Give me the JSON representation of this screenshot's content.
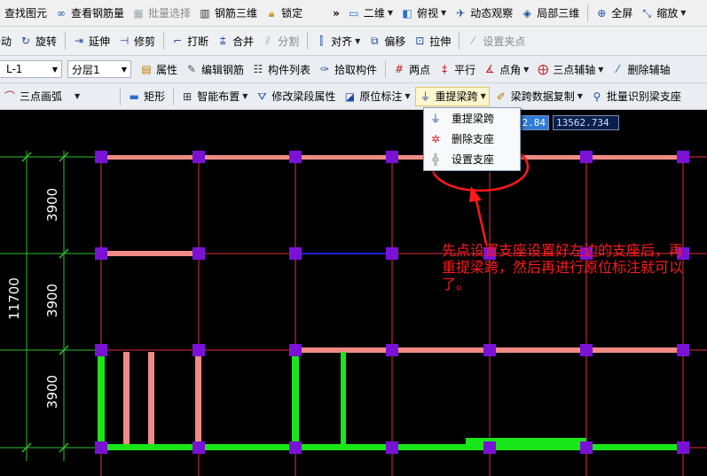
{
  "toolbar1": {
    "find_element": "查找图元",
    "view_rebar_qty": "查看钢筋量",
    "batch_select": "批量选择",
    "rebar_3d": "钢筋三维",
    "lock": "锁定",
    "overflow": "»",
    "view_2d": "二维",
    "top_view": "俯视",
    "dynamic_view": "动态观察",
    "local_3d": "局部三维",
    "full_screen": "全屏",
    "zoom": "缩放"
  },
  "toolbar2": {
    "move": "移动",
    "rotate": "旋转",
    "extend": "延伸",
    "trim": "修剪",
    "break": "打断",
    "merge": "合并",
    "split": "分割",
    "align": "对齐",
    "offset": "偏移",
    "stretch": "拉伸",
    "set_grip": "设置夹点"
  },
  "toolbar3": {
    "element_name": "L-1",
    "floor": "分层1",
    "properties": "属性",
    "edit_rebar": "编辑钢筋",
    "element_list": "构件列表",
    "pick_element": "拾取构件",
    "two_points": "两点",
    "parallel": "平行",
    "point_angle": "点角",
    "three_point_aux": "三点辅轴",
    "delete_aux": "删除辅轴"
  },
  "toolbar4": {
    "three_point_arc": "三点画弧",
    "rectangle": "矩形",
    "smart_layout": "智能布置",
    "modify_beam_props": "修改梁段属性",
    "in_place_label": "原位标注",
    "re_extract_span": "重提梁跨",
    "span_data_copy": "梁跨数据复制",
    "batch_identify_support": "批量识别梁支座"
  },
  "coords": {
    "x_value": "2.84",
    "y_value": "13562.734"
  },
  "dropdown": {
    "items": [
      "重提梁跨",
      "删除支座",
      "设置支座"
    ]
  },
  "dimensions": {
    "row_dims": [
      "3900",
      "3900",
      "3900"
    ],
    "total": "11700"
  },
  "annotation": "先点设置支座设置好左边的支座后，再重提梁跨，然后再进行原位标注就可以了。",
  "colors": {
    "grid_line": "#e0303a",
    "beam_pink": "#f08a84",
    "beam_green": "#19e619",
    "column_purple": "#7a12d6",
    "dim_green": "#2fbf2f",
    "annotation_red": "#ff1a1a"
  },
  "icons": {
    "find": "find-icon",
    "rebar": "rebar-icon",
    "select": "batch-select-icon",
    "rebar3d": "rebar-3d-icon",
    "lock": "lock-icon"
  }
}
